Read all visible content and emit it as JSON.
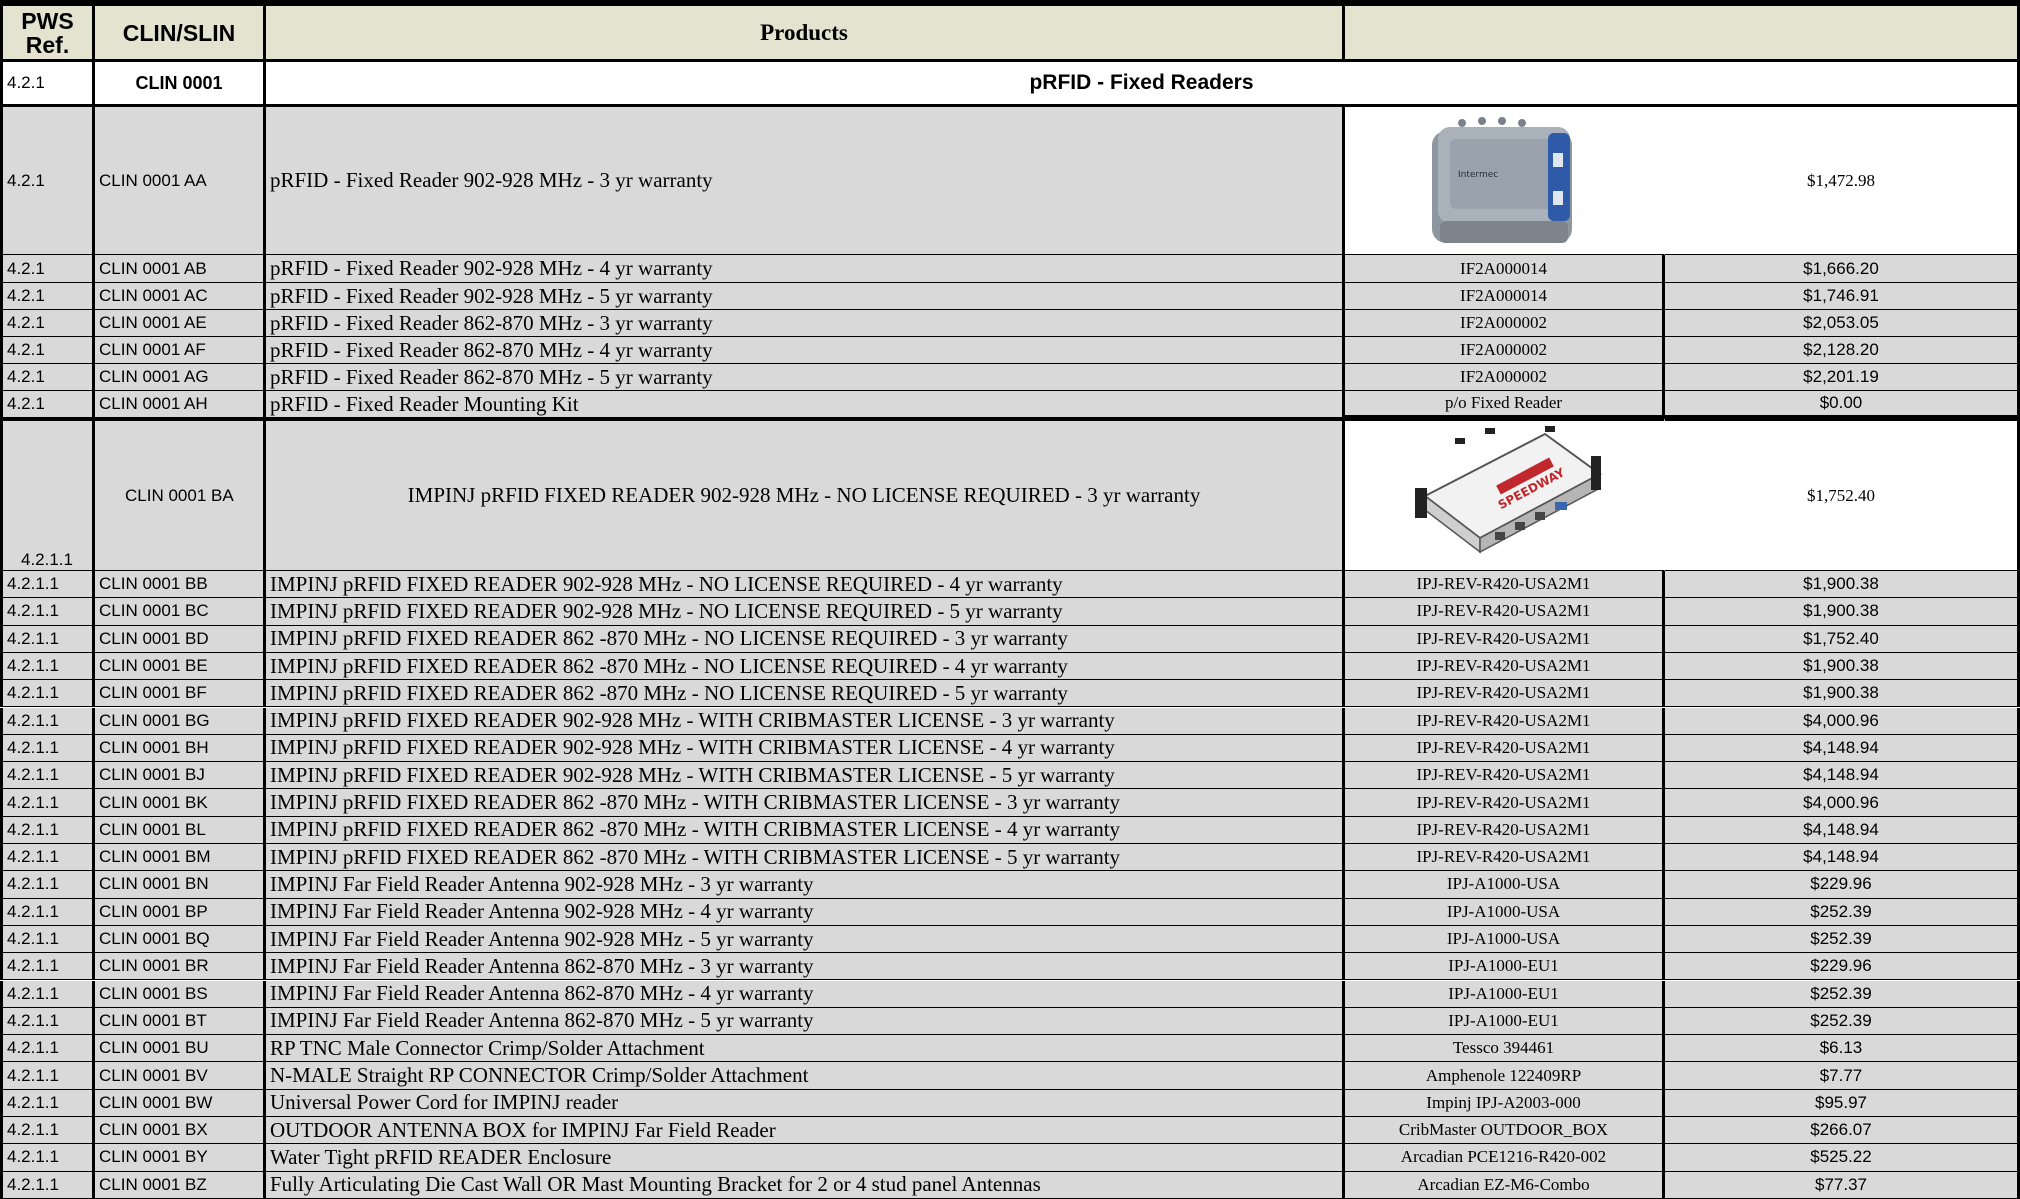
{
  "header": {
    "pws_ref": "PWS Ref.",
    "clin_slin": "CLIN/SLIN",
    "products": "Products",
    "part": ""
  },
  "section": {
    "ref": "4.2.1",
    "clin": "CLIN 0001",
    "title": "pRFID - Fixed Readers"
  },
  "images": {
    "intermec_reader": "intermec-fixed-reader-image",
    "speedway_reader": "impinj-speedway-reader-image",
    "intermec_brand": "Intermec",
    "speedway_brand": "SPEEDWAY"
  },
  "rows": [
    {
      "ref": "4.2.1",
      "clin": "CLIN 0001 AA",
      "product": "pRFID - Fixed Reader 902-928 MHz - 3 yr warranty",
      "part": "",
      "price": "$1,472.98"
    },
    {
      "ref": "4.2.1",
      "clin": "CLIN 0001 AB",
      "product": "pRFID - Fixed Reader 902-928 MHz - 4 yr warranty",
      "part": "IF2A000014",
      "price": "$1,666.20"
    },
    {
      "ref": "4.2.1",
      "clin": "CLIN 0001 AC",
      "product": "pRFID - Fixed Reader 902-928 MHz - 5 yr warranty",
      "part": "IF2A000014",
      "price": "$1,746.91"
    },
    {
      "ref": "4.2.1",
      "clin": "CLIN 0001 AE",
      "product": "pRFID - Fixed Reader 862-870 MHz - 3 yr warranty",
      "part": "IF2A000002",
      "price": "$2,053.05"
    },
    {
      "ref": "4.2.1",
      "clin": "CLIN 0001 AF",
      "product": "pRFID - Fixed Reader 862-870 MHz - 4 yr warranty",
      "part": "IF2A000002",
      "price": "$2,128.20"
    },
    {
      "ref": "4.2.1",
      "clin": "CLIN 0001 AG",
      "product": "pRFID - Fixed Reader 862-870 MHz - 5 yr warranty",
      "part": "IF2A000002",
      "price": "$2,201.19"
    },
    {
      "ref": "4.2.1",
      "clin": "CLIN 0001 AH",
      "product": "pRFID - Fixed Reader Mounting Kit",
      "part": "p/o Fixed Reader",
      "price": "$0.00"
    },
    {
      "ref": "4.2.1.1",
      "clin": "CLIN 0001 BA",
      "product": "IMPINJ pRFID FIXED READER 902-928 MHz - NO LICENSE REQUIRED - 3 yr warranty",
      "part": "",
      "price": "$1,752.40"
    },
    {
      "ref": "4.2.1.1",
      "clin": "CLIN 0001 BB",
      "product": "IMPINJ pRFID FIXED READER 902-928 MHz - NO LICENSE REQUIRED - 4 yr warranty",
      "part": "IPJ-REV-R420-USA2M1",
      "price": "$1,900.38"
    },
    {
      "ref": "4.2.1.1",
      "clin": "CLIN 0001 BC",
      "product": "IMPINJ pRFID FIXED READER 902-928 MHz - NO LICENSE REQUIRED - 5 yr warranty",
      "part": "IPJ-REV-R420-USA2M1",
      "price": "$1,900.38"
    },
    {
      "ref": "4.2.1.1",
      "clin": "CLIN 0001 BD",
      "product": "IMPINJ pRFID FIXED READER 862 -870 MHz - NO LICENSE REQUIRED - 3 yr warranty",
      "part": "IPJ-REV-R420-USA2M1",
      "price": "$1,752.40"
    },
    {
      "ref": "4.2.1.1",
      "clin": "CLIN 0001 BE",
      "product": "IMPINJ pRFID FIXED READER 862 -870 MHz - NO LICENSE REQUIRED - 4 yr warranty",
      "part": "IPJ-REV-R420-USA2M1",
      "price": "$1,900.38"
    },
    {
      "ref": "4.2.1.1",
      "clin": "CLIN 0001 BF",
      "product": "IMPINJ pRFID FIXED READER 862 -870 MHz - NO LICENSE REQUIRED - 5 yr warranty",
      "part": "IPJ-REV-R420-USA2M1",
      "price": "$1,900.38"
    },
    {
      "ref": "4.2.1.1",
      "clin": "CLIN 0001 BG",
      "product": "IMPINJ pRFID FIXED READER 902-928 MHz - WITH CRIBMASTER LICENSE - 3 yr warranty",
      "part": "IPJ-REV-R420-USA2M1",
      "price": "$4,000.96"
    },
    {
      "ref": "4.2.1.1",
      "clin": "CLIN 0001 BH",
      "product": "IMPINJ pRFID FIXED READER 902-928 MHz - WITH CRIBMASTER LICENSE - 4 yr warranty",
      "part": "IPJ-REV-R420-USA2M1",
      "price": "$4,148.94"
    },
    {
      "ref": "4.2.1.1",
      "clin": "CLIN 0001 BJ",
      "product": "IMPINJ pRFID FIXED READER 902-928 MHz - WITH CRIBMASTER LICENSE - 5 yr warranty",
      "part": "IPJ-REV-R420-USA2M1",
      "price": "$4,148.94"
    },
    {
      "ref": "4.2.1.1",
      "clin": "CLIN 0001 BK",
      "product": "IMPINJ pRFID FIXED READER 862 -870 MHz - WITH CRIBMASTER LICENSE - 3 yr warranty",
      "part": "IPJ-REV-R420-USA2M1",
      "price": "$4,000.96"
    },
    {
      "ref": "4.2.1.1",
      "clin": "CLIN 0001 BL",
      "product": "IMPINJ pRFID FIXED READER 862 -870 MHz - WITH CRIBMASTER LICENSE - 4 yr warranty",
      "part": "IPJ-REV-R420-USA2M1",
      "price": "$4,148.94"
    },
    {
      "ref": "4.2.1.1",
      "clin": "CLIN 0001 BM",
      "product": "IMPINJ pRFID FIXED READER 862 -870 MHz - WITH CRIBMASTER LICENSE - 5 yr warranty",
      "part": "IPJ-REV-R420-USA2M1",
      "price": "$4,148.94"
    },
    {
      "ref": "4.2.1.1",
      "clin": "CLIN 0001 BN",
      "product": "IMPINJ Far Field Reader Antenna 902-928 MHz - 3 yr warranty",
      "part": "IPJ-A1000-USA",
      "price": "$229.96"
    },
    {
      "ref": "4.2.1.1",
      "clin": "CLIN 0001 BP",
      "product": "IMPINJ Far Field Reader Antenna 902-928 MHz - 4 yr warranty",
      "part": "IPJ-A1000-USA",
      "price": "$252.39"
    },
    {
      "ref": "4.2.1.1",
      "clin": "CLIN 0001 BQ",
      "product": "IMPINJ Far Field Reader Antenna 902-928 MHz - 5 yr warranty",
      "part": "IPJ-A1000-USA",
      "price": "$252.39"
    },
    {
      "ref": "4.2.1.1",
      "clin": "CLIN 0001 BR",
      "product": "IMPINJ Far Field Reader Antenna 862-870 MHz - 3 yr warranty",
      "part": "IPJ-A1000-EU1",
      "price": "$229.96"
    },
    {
      "ref": "4.2.1.1",
      "clin": "CLIN 0001 BS",
      "product": "IMPINJ Far Field Reader Antenna 862-870 MHz - 4 yr warranty",
      "part": "IPJ-A1000-EU1",
      "price": "$252.39"
    },
    {
      "ref": "4.2.1.1",
      "clin": "CLIN 0001 BT",
      "product": "IMPINJ Far Field Reader Antenna 862-870 MHz - 5 yr warranty",
      "part": "IPJ-A1000-EU1",
      "price": "$252.39"
    },
    {
      "ref": "4.2.1.1",
      "clin": "CLIN 0001 BU",
      "product": "RP TNC Male Connector Crimp/Solder Attachment",
      "part": "Tessco 394461",
      "price": "$6.13"
    },
    {
      "ref": "4.2.1.1",
      "clin": "CLIN 0001 BV",
      "product": "N-MALE Straight RP CONNECTOR Crimp/Solder Attachment",
      "part": "Amphenole 122409RP",
      "price": "$7.77"
    },
    {
      "ref": "4.2.1.1",
      "clin": "CLIN 0001 BW",
      "product": "Universal Power Cord for IMPINJ reader",
      "part": "Impinj IPJ-A2003-000",
      "price": "$95.97"
    },
    {
      "ref": "4.2.1.1",
      "clin": "CLIN 0001 BX",
      "product": "OUTDOOR ANTENNA BOX for IMPINJ Far Field Reader",
      "part": "CribMaster OUTDOOR_BOX",
      "price": "$266.07"
    },
    {
      "ref": "4.2.1.1",
      "clin": "CLIN 0001 BY",
      "product": "Water Tight pRFID READER Enclosure",
      "part": "Arcadian PCE1216-R420-002",
      "price": "$525.22"
    },
    {
      "ref": "4.2.1.1",
      "clin": "CLIN 0001 BZ",
      "product": "Fully Articulating Die Cast Wall OR Mast Mounting Bracket for 2 or 4 stud panel Antennas",
      "part": "Arcadian EZ-M6-Combo",
      "price": "$77.37"
    }
  ]
}
